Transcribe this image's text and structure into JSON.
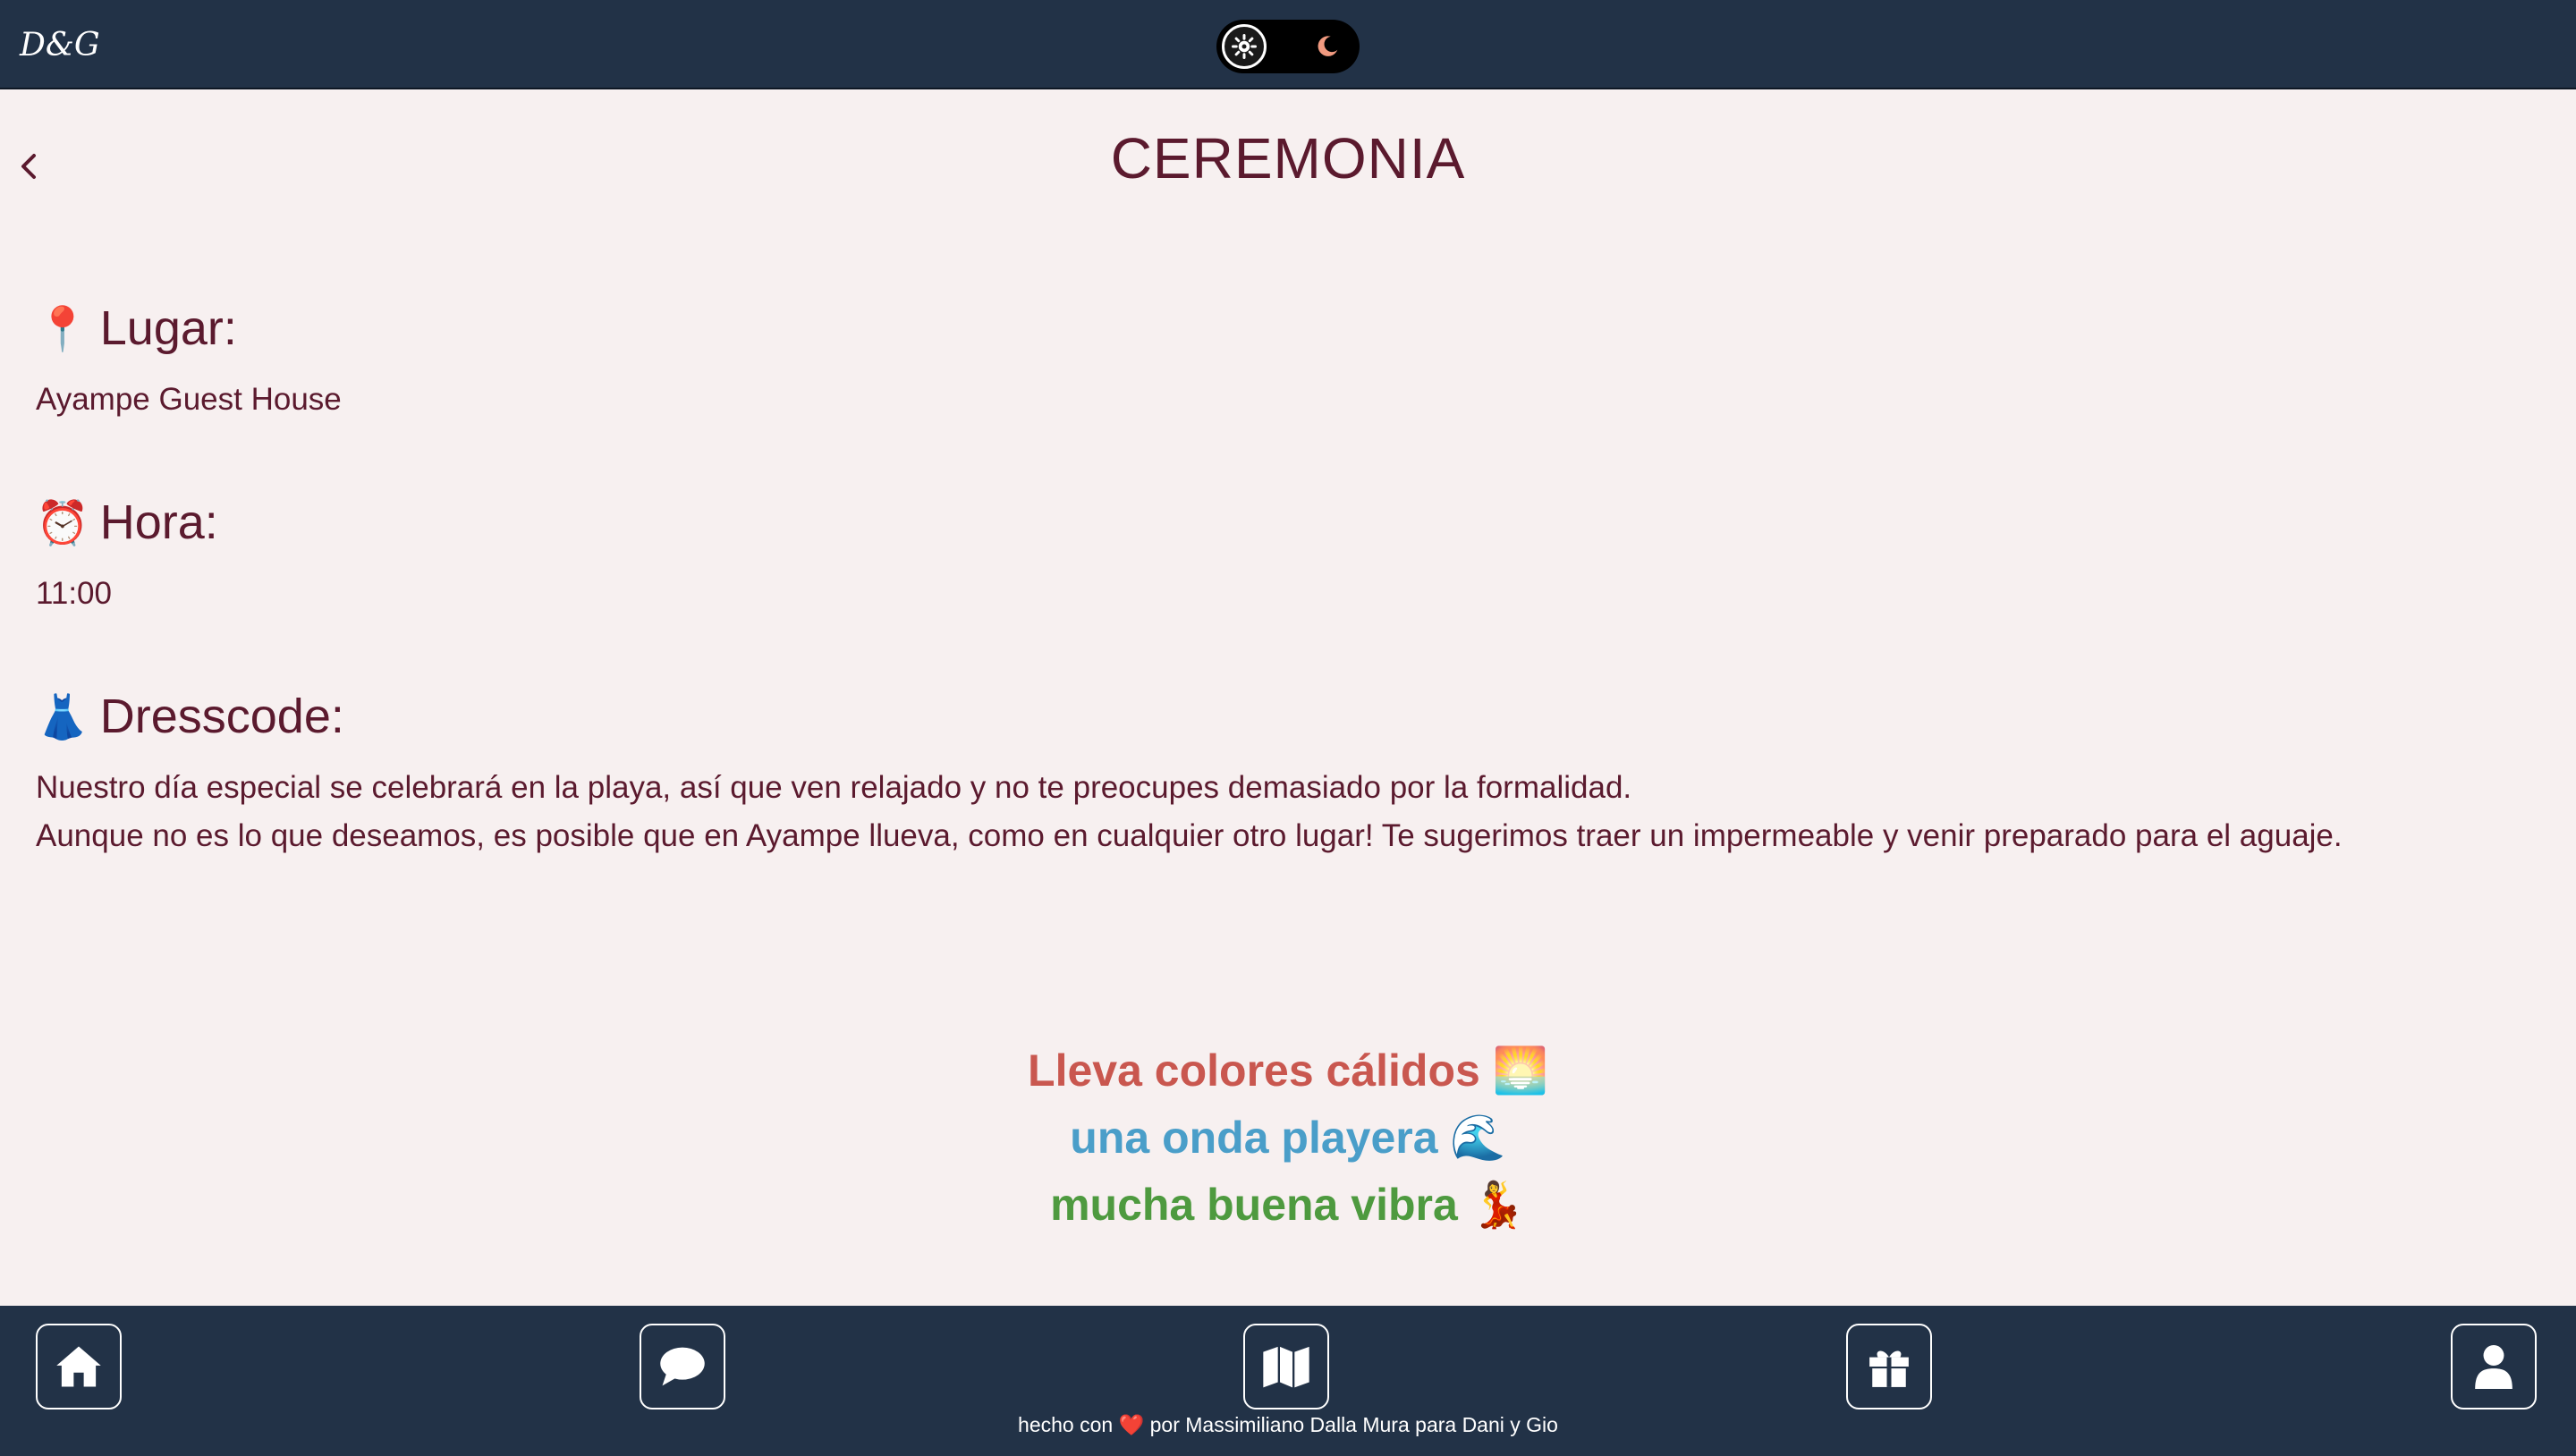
{
  "header": {
    "logo_text": "D&G",
    "theme_toggle": {
      "selected": "light",
      "light_icon": "gear-sun-icon",
      "dark_icon": "moon-icon"
    }
  },
  "page": {
    "title": "CEREMONIA",
    "back_icon": "chevron-left-icon"
  },
  "sections": {
    "lugar": {
      "emoji": "📍",
      "heading": "Lugar:",
      "text": "Ayampe Guest House"
    },
    "hora": {
      "emoji": "⏰",
      "heading": "Hora:",
      "text": "11:00"
    },
    "dresscode": {
      "emoji": "👗",
      "heading": "Dresscode:",
      "line1": "Nuestro día especial se celebrará en la playa, así que ven relajado y no te preocupes demasiado por la formalidad.",
      "line2": "Aunque no es lo que deseamos, es posible que en Ayampe llueva, como en cualquier otro lugar! Te sugerimos traer un impermeable y venir preparado para el aguaje."
    }
  },
  "vibes": [
    {
      "text": "Lleva colores cálidos 🌅",
      "color": "#c9574f"
    },
    {
      "text": "una onda playera 🌊",
      "color": "#4a9ec9"
    },
    {
      "text": "mucha buena vibra 💃",
      "color": "#4e9a3f"
    }
  ],
  "bottom_nav": {
    "items": [
      {
        "icon": "home-icon"
      },
      {
        "icon": "chat-icon"
      },
      {
        "icon": "map-icon"
      },
      {
        "icon": "gift-icon"
      },
      {
        "icon": "user-icon"
      }
    ],
    "footer_prefix": "hecho con",
    "footer_heart": "❤️",
    "footer_suffix": "por Massimiliano Dalla Mura para Dani y Gio"
  },
  "colors": {
    "topbar_bg": "#223247",
    "page_bg": "#f7f0f0",
    "text": "#5b1a2e"
  }
}
